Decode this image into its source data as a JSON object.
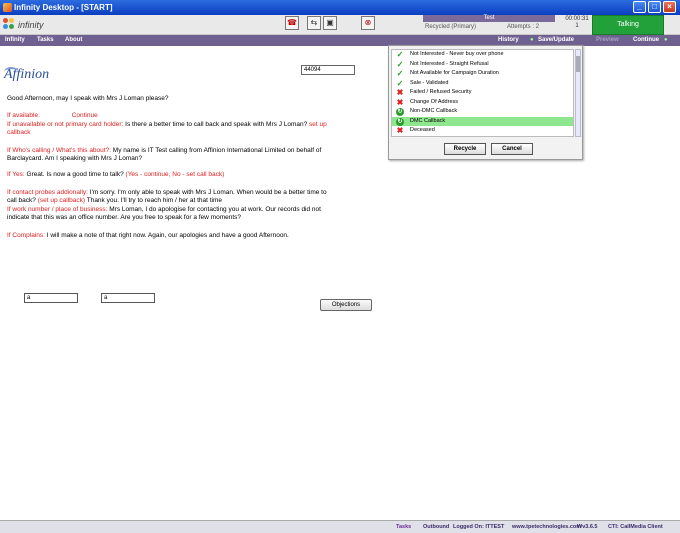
{
  "window": {
    "title": "Infinity Desktop - [START]"
  },
  "header": {
    "logo_text": "infinity",
    "campaign": "Test",
    "status_label": "Recycled (Primary)",
    "attempts": "Attempts : 2",
    "timer": "00:00:31",
    "timer_sub": "1",
    "state": "Talking"
  },
  "menu": {
    "items": [
      "Infinity",
      "Tasks",
      "About"
    ],
    "history": "History",
    "save_update": "Save/Update",
    "preview": "Preview",
    "continue": "Continue"
  },
  "script": {
    "brand": "Affinion",
    "account_number": "44094",
    "greeting": "Good Afternoon, may I speak with Mrs J Loman please?",
    "if_available": "If available:",
    "continue_link": "Continue",
    "if_unavailable": "If unavailable or not primary card holder:",
    "unavailable_text": " Is there a better time to call back and speak with Mrs J Loman? ",
    "setup_callback": "set up callback",
    "who_calling": "If Who's calling / What's this about?:",
    "who_text": " My name is IT Test calling from Affinion International Limited on behalf of Barclaycard. Am I speaking with Mrs J Loman?",
    "if_yes": "If Yes:",
    "yes_text": " Great. Is now a good time to talk? ",
    "yes_options": "(Yes - continue, No - set call back)",
    "contact_probes": "If contact probes addionally:",
    "probes_text1": " I'm sorry. I'm only able to speak with Mrs J Loman. When would be a better time to call back? ",
    "probes_link": "(set up callback)",
    "probes_text2": " Thank you. I'll try to reach him / her at that time",
    "work_number": "If work number / place of business:",
    "work_text": " Mrs Loman, I do apologise for contacting you at work. Our records did not indicate that this was an office number. Are you free to speak for a few moments?",
    "complains": "If Complains:",
    "complains_text": " I will make a note of that right now. Again, our apologies and have a good Afternoon.",
    "field1": "a",
    "field2": "a",
    "objections": "Objections"
  },
  "popup": {
    "items": [
      {
        "label": "Not Interested - Never buy over phone",
        "icon": "check-icon"
      },
      {
        "label": "Not Interested - Straight Refusal",
        "icon": "check-icon"
      },
      {
        "label": "Not Available for Campaign Duration",
        "icon": "check-icon"
      },
      {
        "label": "Sale - Validated",
        "icon": "check-icon"
      },
      {
        "label": "Failed / Refused Security",
        "icon": "cross-icon"
      },
      {
        "label": "Change Of Address",
        "icon": "cross-icon"
      },
      {
        "label": "Non-DMC Callback",
        "icon": "callback-icon"
      },
      {
        "label": "DMC Callback",
        "icon": "callback-icon"
      },
      {
        "label": "Deceased",
        "icon": "cross-icon"
      }
    ],
    "recycle": "Recycle",
    "cancel": "Cancel"
  },
  "status": {
    "tasks": "Tasks",
    "mode": "Outbound",
    "logged_on": "Logged On: ITTEST",
    "site": "www.tpetechnologies.com",
    "version": "Wv3.6.5",
    "cti": "CTI: CallMedia Client"
  }
}
